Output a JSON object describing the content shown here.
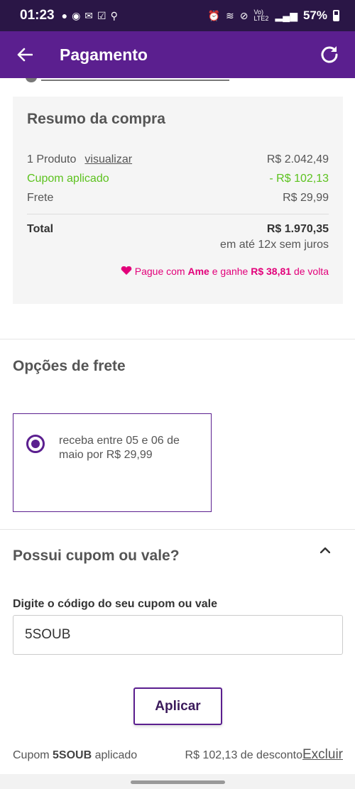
{
  "status_bar": {
    "time": "01:23",
    "battery": "57%",
    "network": "Vo) LTE2"
  },
  "app_bar": {
    "title": "Pagamento"
  },
  "summary": {
    "title": "Resumo da compra",
    "products_label": "1 Produto",
    "view_link": "visualizar",
    "products_value": "R$ 2.042,49",
    "coupon_label": "Cupom aplicado",
    "coupon_value": "- R$ 102,13",
    "shipping_label": "Frete",
    "shipping_value": "R$ 29,99",
    "total_label": "Total",
    "total_value": "R$ 1.970,35",
    "installments": "em até 12x sem juros",
    "ame_prefix": "Pague com ",
    "ame_brand": "Ame",
    "ame_middle": " e ganhe ",
    "ame_amount": "R$ 38,81",
    "ame_suffix": " de volta"
  },
  "shipping": {
    "title": "Opções de frete",
    "option_text": "receba entre 05 e 06 de maio por R$ 29,99"
  },
  "coupon": {
    "title": "Possui cupom ou vale?",
    "input_label": "Digite o código do seu cupom ou vale",
    "input_value": "5SOUB",
    "apply_button": "Aplicar",
    "applied_prefix": "Cupom ",
    "applied_code": "5SOUB",
    "applied_suffix": " aplicado",
    "discount_text": "R$ 102,13 de desconto",
    "remove_link": "Excluir"
  },
  "colors": {
    "primary": "#5b1f8f",
    "green": "#5cc21e",
    "ame_pink": "#e2007a"
  }
}
